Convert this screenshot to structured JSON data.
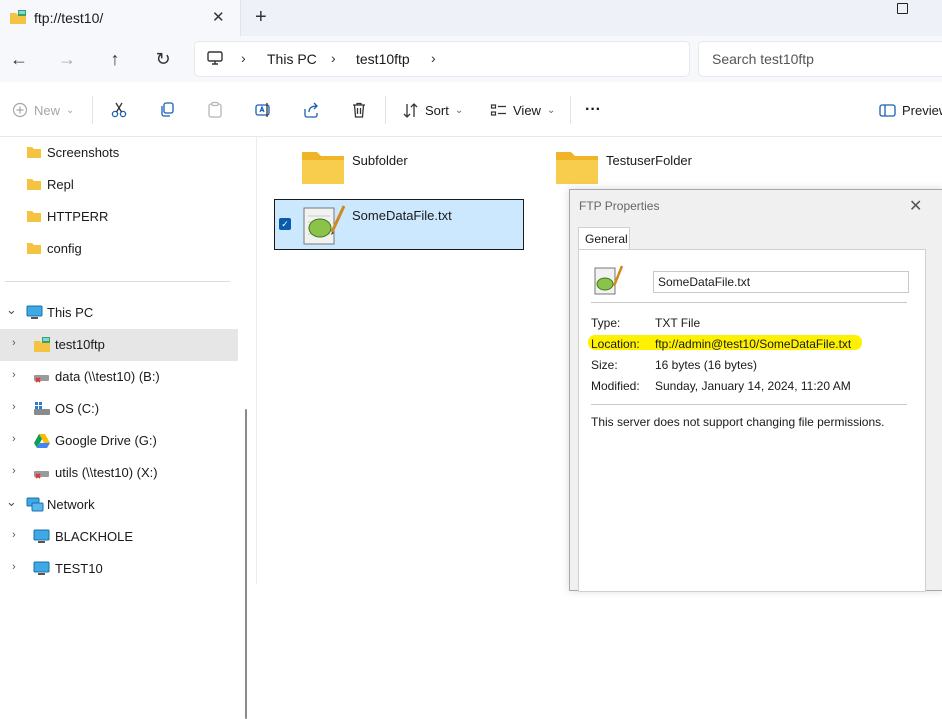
{
  "window": {
    "tab_title": "ftp://test10/",
    "tab_close": "✕",
    "new_tab": "+"
  },
  "nav": {
    "back": "←",
    "forward": "→",
    "up": "↑",
    "refresh": "↻",
    "breadcrumbs": [
      "This PC",
      "test10ftp"
    ],
    "crumb_sep": "›",
    "search_placeholder": "Search test10ftp"
  },
  "toolbar": {
    "new_label": "New",
    "sort_label": "Sort",
    "view_label": "View",
    "more_label": "···",
    "preview_label": "Preview",
    "dropdown": "⌄"
  },
  "sidebar": {
    "quick_items": [
      "Screenshots",
      "Repl",
      "HTTPERR",
      "config"
    ],
    "this_pc": "This PC",
    "drives": [
      "test10ftp",
      "data (\\\\test10) (B:)",
      "OS (C:)",
      "Google Drive (G:)",
      "utils (\\\\test10) (X:)"
    ],
    "network": "Network",
    "network_items": [
      "BLACKHOLE",
      "TEST10"
    ],
    "expanded_chevron": "⌄",
    "collapsed_chevron": "›"
  },
  "content": {
    "items": [
      "Subfolder",
      "TestuserFolder",
      "SomeDataFile.txt"
    ],
    "check": "✓"
  },
  "dialog": {
    "title": "FTP Properties",
    "close": "✕",
    "tab": "General",
    "file_name": "SomeDataFile.txt",
    "type_label": "Type:",
    "type_value": "TXT File",
    "location_label": "Location:",
    "location_value": "ftp://admin@test10/SomeDataFile.txt",
    "size_label": "Size:",
    "size_value": "16 bytes (16 bytes)",
    "modified_label": "Modified:",
    "modified_value": "Sunday, January 14, 2024, 11:20 AM",
    "note": "This server does not support changing file permissions."
  },
  "colors": {
    "folder": "#f5c342",
    "selection": "#cce8ff",
    "accent": "#0b5cad",
    "highlight": "#fff200"
  }
}
